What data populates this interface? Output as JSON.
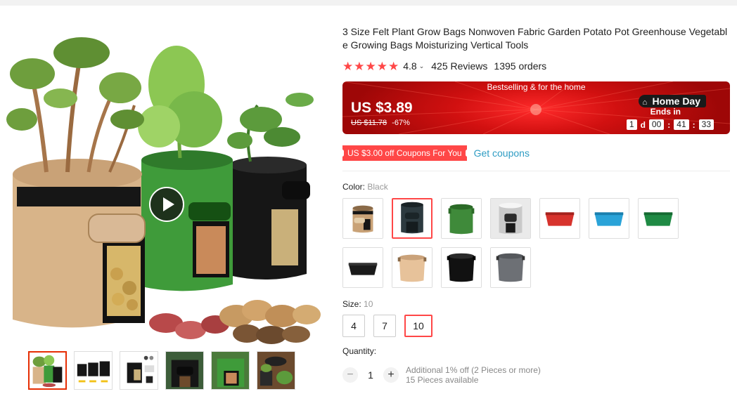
{
  "product": {
    "title": "3 Size Felt Plant Grow Bags Nonwoven Fabric Garden Potato Pot Greenhouse Vegetable Growing Bags Moisturizing Vertical Tools",
    "rating": "4.8",
    "rating_stars": 5,
    "reviews": "425 Reviews",
    "orders": "1395 orders"
  },
  "banner": {
    "headline": "Bestselling & for the home",
    "price": "US $3.89",
    "original_price": "US $11.78",
    "discount": "-67%",
    "promo_name": "Home Day",
    "ends_in": "Ends in",
    "countdown": {
      "days": "1",
      "day_unit": "d",
      "hours": "00",
      "minutes": "41",
      "seconds": "33"
    }
  },
  "coupon": {
    "tag": "US $3.00 off Coupons For You",
    "link": "Get coupons"
  },
  "color": {
    "label": "Color:",
    "selected": "Black",
    "swatch_names": [
      "tan-potato-bag-swatch",
      "black-potato-bag-swatch",
      "green-potato-bag-swatch",
      "gray-potato-bag-swatch",
      "red-raised-bed-swatch",
      "blue-raised-bed-swatch",
      "green-raised-bed-swatch",
      "black-raised-bed-swatch",
      "tan-grow-pot-swatch",
      "black-grow-pot-swatch",
      "gray-grow-pot-swatch"
    ],
    "selected_index": 1
  },
  "size": {
    "label": "Size:",
    "selected": "10",
    "options": [
      "4",
      "7",
      "10"
    ]
  },
  "quantity": {
    "label": "Quantity:",
    "value": "1",
    "minus": "−",
    "plus": "+",
    "note_line1": "Additional 1% off (2 Pieces or more)",
    "note_line2": "15 Pieces available"
  },
  "gallery": {
    "thumb_count": 6,
    "active_thumb": 0
  },
  "colors": {
    "accent_red": "#ff4747",
    "link_blue": "#2e9cc3",
    "banner_red": "#d11010"
  }
}
